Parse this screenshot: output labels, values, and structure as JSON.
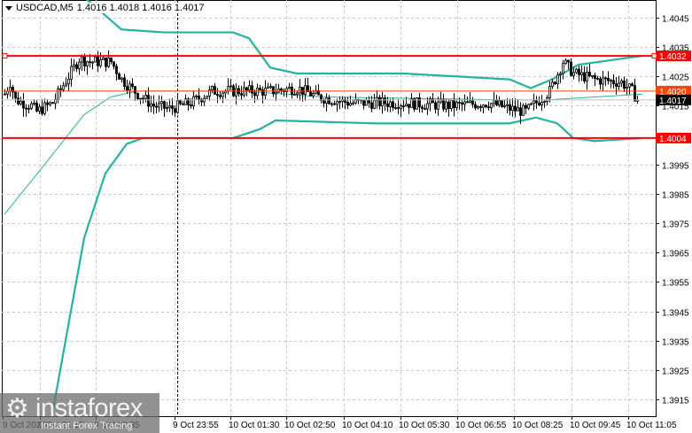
{
  "header": {
    "symbol": "USDCAD,M5",
    "ohlc": "1.4016 1.4018 1.4016 1.4017",
    "menu_icon": "triangle-down-icon"
  },
  "logo": {
    "brand": "instaforex",
    "tagline": "Instant Forex Tracing",
    "icon": "gear-person-icon"
  },
  "chart_data": {
    "type": "candlestick",
    "symbol": "USDCAD",
    "timeframe": "M5",
    "ylim": [
      1.391,
      1.405
    ],
    "y_ticks": [
      "1.4045",
      "1.4035",
      "1.4025",
      "1.4015",
      "1.3995",
      "1.3985",
      "1.3975",
      "1.3965",
      "1.3955",
      "1.3945",
      "1.3935",
      "1.3925",
      "1.3915"
    ],
    "x_ticks": [
      "9 Oct 2025",
      "9 Oct 21:15",
      "9 Oct 22:35",
      "9 Oct 23:55",
      "10 Oct 01:30",
      "10 Oct 02:50",
      "10 Oct 04:10",
      "10 Oct 05:30",
      "10 Oct 06:55",
      "10 Oct 08:25",
      "10 Oct 09:45",
      "10 Oct 11:05"
    ],
    "bar_count": 178,
    "price_path": [
      [
        0,
        1.4019
      ],
      [
        2,
        1.4023
      ],
      [
        4,
        1.4017
      ],
      [
        10,
        1.4015
      ],
      [
        12,
        1.4013
      ],
      [
        18,
        1.4016
      ],
      [
        24,
        1.4025
      ],
      [
        28,
        1.4031
      ],
      [
        32,
        1.403
      ],
      [
        40,
        1.403
      ],
      [
        44,
        1.4024
      ],
      [
        50,
        1.4019
      ],
      [
        56,
        1.4015
      ],
      [
        62,
        1.4014
      ],
      [
        70,
        1.4016
      ],
      [
        78,
        1.402
      ],
      [
        90,
        1.402
      ],
      [
        100,
        1.402
      ],
      [
        110,
        1.4021
      ],
      [
        118,
        1.4018
      ],
      [
        130,
        1.4016
      ],
      [
        150,
        1.4016
      ],
      [
        168,
        1.4015
      ],
      [
        182,
        1.4016
      ],
      [
        190,
        1.4014
      ],
      [
        196,
        1.4013
      ],
      [
        205,
        1.402
      ],
      [
        210,
        1.403
      ],
      [
        214,
        1.4026
      ],
      [
        222,
        1.4024
      ],
      [
        232,
        1.4023
      ],
      [
        236,
        1.402
      ],
      [
        238,
        1.4017
      ]
    ],
    "bands": {
      "upper": [
        [
          20,
          1.4064
        ],
        [
          30,
          1.4052
        ],
        [
          44,
          1.4041
        ],
        [
          60,
          1.404
        ],
        [
          86,
          1.404
        ],
        [
          92,
          1.4038
        ],
        [
          100,
          1.4028
        ],
        [
          110,
          1.4026
        ],
        [
          150,
          1.4026
        ],
        [
          190,
          1.4024
        ],
        [
          198,
          1.4021
        ],
        [
          206,
          1.4024
        ],
        [
          216,
          1.4029
        ],
        [
          240,
          1.4032
        ]
      ],
      "middle": [
        [
          0,
          1.3978
        ],
        [
          16,
          1.3996
        ],
        [
          30,
          1.4012
        ],
        [
          40,
          1.4018
        ],
        [
          50,
          1.402
        ],
        [
          90,
          1.402
        ],
        [
          120,
          1.4018
        ],
        [
          190,
          1.4017
        ],
        [
          204,
          1.4017
        ],
        [
          240,
          1.4019
        ]
      ],
      "lower": [
        [
          18,
          1.391
        ],
        [
          24,
          1.394
        ],
        [
          30,
          1.397
        ],
        [
          38,
          1.3992
        ],
        [
          46,
          1.4002
        ],
        [
          52,
          1.4004
        ],
        [
          86,
          1.4004
        ],
        [
          96,
          1.4007
        ],
        [
          102,
          1.401
        ],
        [
          140,
          1.4009
        ],
        [
          190,
          1.4009
        ],
        [
          200,
          1.4011
        ],
        [
          208,
          1.4009
        ],
        [
          214,
          1.4004
        ],
        [
          222,
          1.4003
        ],
        [
          240,
          1.4004
        ]
      ],
      "color": "#26b2a0"
    },
    "levels": [
      {
        "price": "1.4032",
        "color": "#ff0000",
        "style": "thick"
      },
      {
        "price": "1.4004",
        "color": "#ff0000",
        "style": "thick"
      },
      {
        "price": "1.4020",
        "color": "#ff4500",
        "style": "thin"
      },
      {
        "price": "1.4017",
        "color": "#000000",
        "style": "bid"
      }
    ]
  }
}
